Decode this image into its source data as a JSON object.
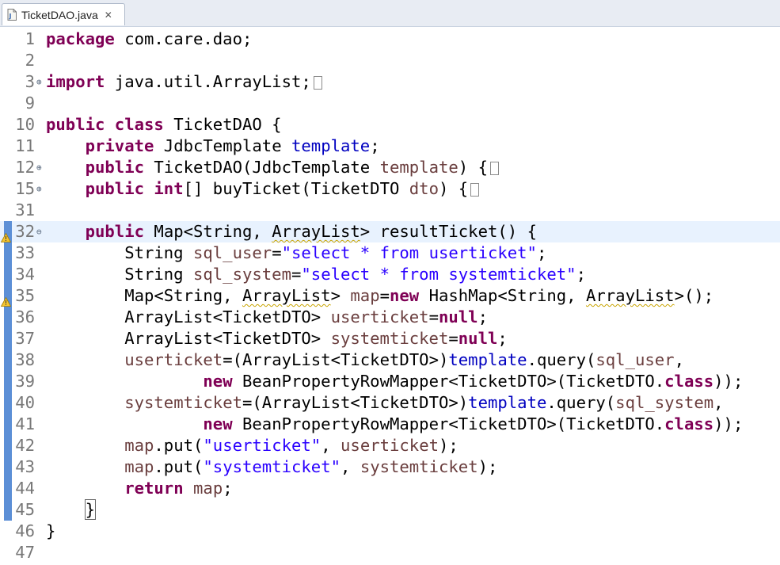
{
  "tab": {
    "title": "TicketDAO.java",
    "close_glyph": "✕"
  },
  "editor": {
    "lines": [
      {
        "num": "1",
        "parts": [
          [
            "kw",
            "package"
          ],
          [
            "def",
            " com.care.dao;"
          ]
        ]
      },
      {
        "num": "2",
        "parts": []
      },
      {
        "num": "3",
        "fold": "expand",
        "parts": [
          [
            "kw",
            "import"
          ],
          [
            "def",
            " java.util.ArrayList;"
          ]
        ],
        "folded": true
      },
      {
        "num": "9",
        "parts": []
      },
      {
        "num": "10",
        "parts": [
          [
            "kw",
            "public class"
          ],
          [
            "def",
            " TicketDAO {"
          ]
        ]
      },
      {
        "num": "11",
        "parts": [
          [
            "def",
            "    "
          ],
          [
            "kw",
            "private"
          ],
          [
            "def",
            " JdbcTemplate "
          ],
          [
            "fld",
            "template"
          ],
          [
            "def",
            ";"
          ]
        ]
      },
      {
        "num": "12",
        "fold": "expand",
        "parts": [
          [
            "def",
            "    "
          ],
          [
            "kw",
            "public"
          ],
          [
            "def",
            " TicketDAO(JdbcTemplate "
          ],
          [
            "par",
            "template"
          ],
          [
            "def",
            ") {"
          ]
        ],
        "folded": true
      },
      {
        "num": "15",
        "fold": "expand",
        "parts": [
          [
            "def",
            "    "
          ],
          [
            "kw",
            "public int"
          ],
          [
            "def",
            "[] buyTicket(TicketDTO "
          ],
          [
            "par",
            "dto"
          ],
          [
            "def",
            ") {"
          ]
        ],
        "folded": true
      },
      {
        "num": "31",
        "parts": []
      },
      {
        "num": "32",
        "fold": "collapse",
        "current": true,
        "warning": true,
        "parts": [
          [
            "def",
            "    "
          ],
          [
            "kw",
            "public"
          ],
          [
            "def",
            " Map<String, "
          ],
          [
            "warn",
            "ArrayList"
          ],
          [
            "def",
            "> resultTicket() {"
          ]
        ]
      },
      {
        "num": "33",
        "changed": true,
        "parts": [
          [
            "def",
            "        String "
          ],
          [
            "loc",
            "sql_user"
          ],
          [
            "def",
            "="
          ],
          [
            "str",
            "\"select * from userticket\""
          ],
          [
            "def",
            ";"
          ]
        ]
      },
      {
        "num": "34",
        "changed": true,
        "parts": [
          [
            "def",
            "        String "
          ],
          [
            "loc",
            "sql_system"
          ],
          [
            "def",
            "="
          ],
          [
            "str",
            "\"select * from systemticket\""
          ],
          [
            "def",
            ";"
          ]
        ]
      },
      {
        "num": "35",
        "changed": true,
        "warning": true,
        "parts": [
          [
            "def",
            "        Map<String, "
          ],
          [
            "warn",
            "ArrayList"
          ],
          [
            "def",
            "> "
          ],
          [
            "loc",
            "map"
          ],
          [
            "def",
            "="
          ],
          [
            "kw",
            "new"
          ],
          [
            "def",
            " HashMap<String, "
          ],
          [
            "warn",
            "ArrayList"
          ],
          [
            "def",
            ">();"
          ]
        ]
      },
      {
        "num": "36",
        "changed": true,
        "parts": [
          [
            "def",
            "        ArrayList<TicketDTO> "
          ],
          [
            "loc",
            "userticket"
          ],
          [
            "def",
            "="
          ],
          [
            "kw",
            "null"
          ],
          [
            "def",
            ";"
          ]
        ]
      },
      {
        "num": "37",
        "changed": true,
        "parts": [
          [
            "def",
            "        ArrayList<TicketDTO> "
          ],
          [
            "loc",
            "systemticket"
          ],
          [
            "def",
            "="
          ],
          [
            "kw",
            "null"
          ],
          [
            "def",
            ";"
          ]
        ]
      },
      {
        "num": "38",
        "changed": true,
        "parts": [
          [
            "def",
            "        "
          ],
          [
            "loc",
            "userticket"
          ],
          [
            "def",
            "=(ArrayList<TicketDTO>)"
          ],
          [
            "fld",
            "template"
          ],
          [
            "def",
            ".query("
          ],
          [
            "loc",
            "sql_user"
          ],
          [
            "def",
            ","
          ]
        ]
      },
      {
        "num": "39",
        "changed": true,
        "parts": [
          [
            "def",
            "                "
          ],
          [
            "kw",
            "new"
          ],
          [
            "def",
            " BeanPropertyRowMapper<TicketDTO>(TicketDTO."
          ],
          [
            "kw",
            "class"
          ],
          [
            "def",
            "));"
          ]
        ]
      },
      {
        "num": "40",
        "changed": true,
        "parts": [
          [
            "def",
            "        "
          ],
          [
            "loc",
            "systemticket"
          ],
          [
            "def",
            "=(ArrayList<TicketDTO>)"
          ],
          [
            "fld",
            "template"
          ],
          [
            "def",
            ".query("
          ],
          [
            "loc",
            "sql_system"
          ],
          [
            "def",
            ","
          ]
        ]
      },
      {
        "num": "41",
        "changed": true,
        "parts": [
          [
            "def",
            "                "
          ],
          [
            "kw",
            "new"
          ],
          [
            "def",
            " BeanPropertyRowMapper<TicketDTO>(TicketDTO."
          ],
          [
            "kw",
            "class"
          ],
          [
            "def",
            "));"
          ]
        ]
      },
      {
        "num": "42",
        "changed": true,
        "parts": [
          [
            "def",
            "        "
          ],
          [
            "loc",
            "map"
          ],
          [
            "def",
            ".put("
          ],
          [
            "str",
            "\"userticket\""
          ],
          [
            "def",
            ", "
          ],
          [
            "loc",
            "userticket"
          ],
          [
            "def",
            ");"
          ]
        ]
      },
      {
        "num": "43",
        "changed": true,
        "parts": [
          [
            "def",
            "        "
          ],
          [
            "loc",
            "map"
          ],
          [
            "def",
            ".put("
          ],
          [
            "str",
            "\"systemticket\""
          ],
          [
            "def",
            ", "
          ],
          [
            "loc",
            "systemticket"
          ],
          [
            "def",
            ");"
          ]
        ]
      },
      {
        "num": "44",
        "changed": true,
        "parts": [
          [
            "def",
            "        "
          ],
          [
            "kw",
            "return"
          ],
          [
            "def",
            " "
          ],
          [
            "loc",
            "map"
          ],
          [
            "def",
            ";"
          ]
        ]
      },
      {
        "num": "45",
        "changed": true,
        "parts": [
          [
            "def",
            "    "
          ],
          [
            "brace",
            "}"
          ]
        ]
      },
      {
        "num": "46",
        "parts": [
          [
            "def",
            "}"
          ]
        ]
      },
      {
        "num": "47",
        "parts": []
      }
    ]
  },
  "colors": {
    "keyword": "#7f0055",
    "field": "#0000c0",
    "string": "#2a00ff",
    "param": "#6a3e3e",
    "local": "#6a3e3e",
    "current_line": "#e8f2fe",
    "change_bar": "#5c8fd6"
  }
}
